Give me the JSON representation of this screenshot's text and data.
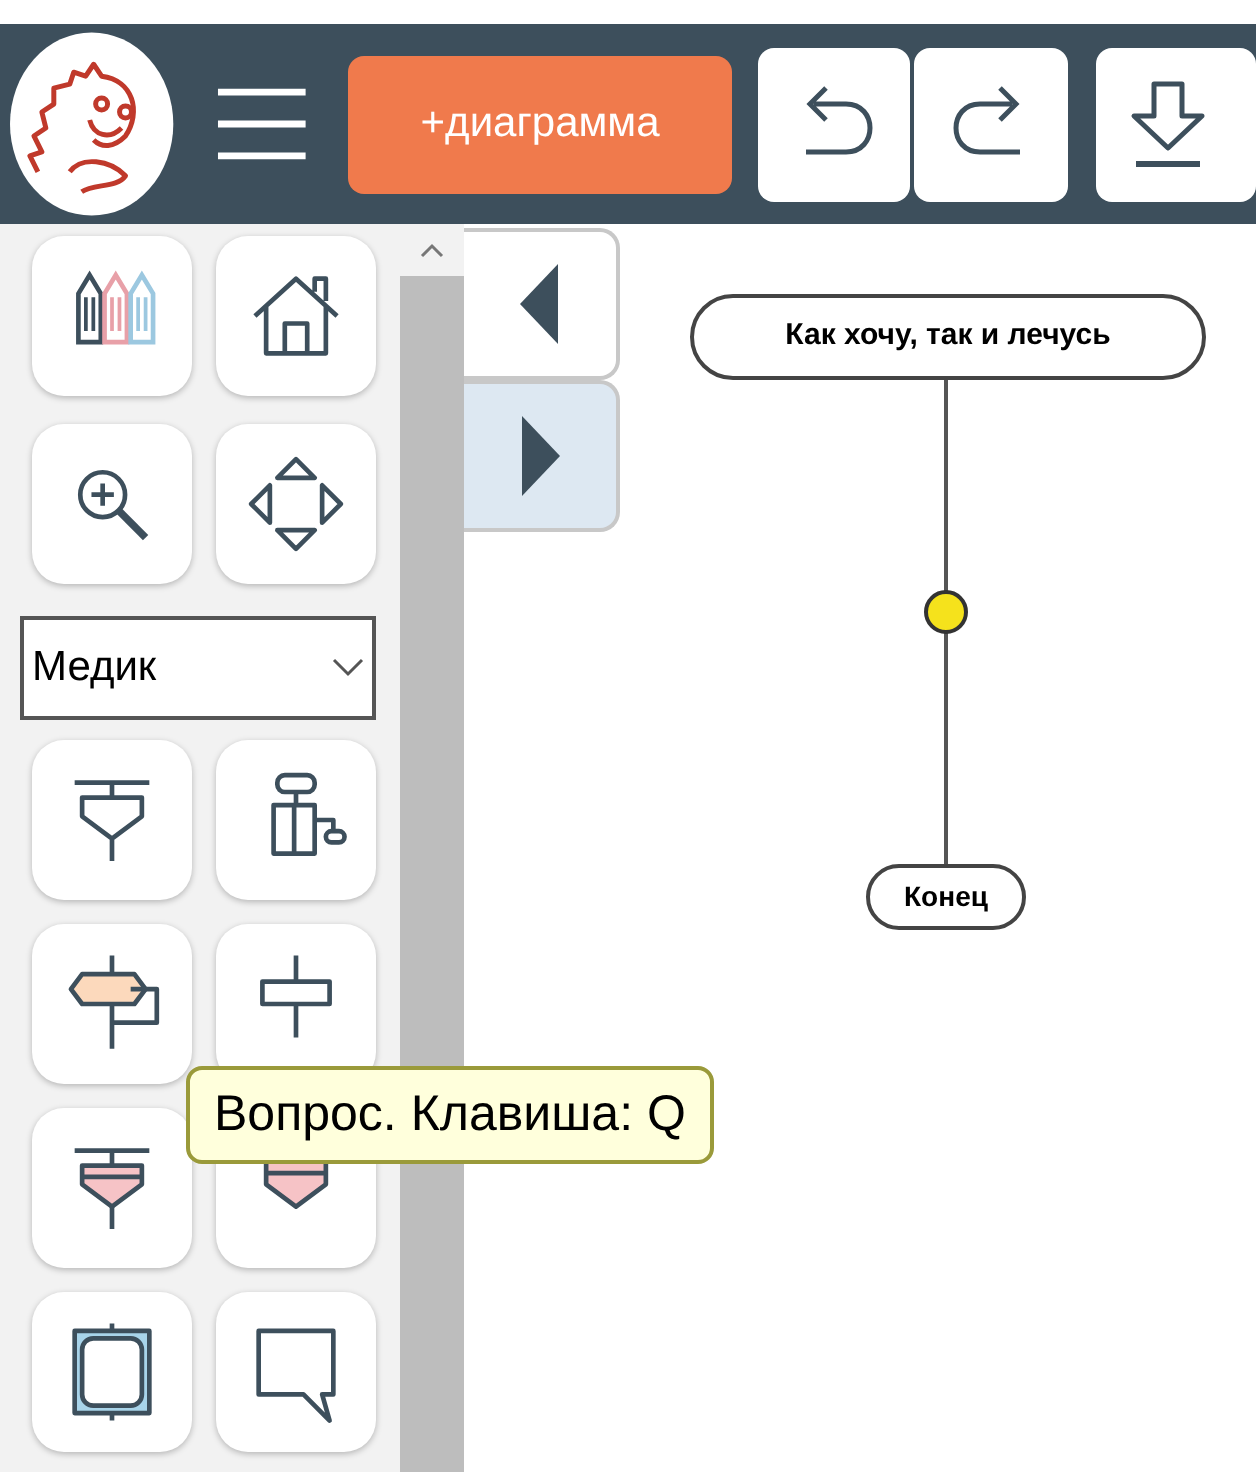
{
  "header": {
    "new_diagram_button": "+диаграмма"
  },
  "sidebar": {
    "tools_top": [
      {
        "kind": "pencils"
      },
      {
        "kind": "home"
      },
      {
        "kind": "zoom"
      },
      {
        "kind": "move"
      }
    ],
    "preset_select": {
      "value": "Медик"
    },
    "tools": [
      {
        "kind": "loop-start"
      },
      {
        "kind": "branch"
      },
      {
        "kind": "hex-loop"
      },
      {
        "kind": "action"
      },
      {
        "kind": "loop-start-pink"
      },
      {
        "kind": "loop-end-pink"
      },
      {
        "kind": "frame"
      },
      {
        "kind": "callout"
      }
    ]
  },
  "panel_tabs": [
    {
      "kind": "collapse",
      "selected": false
    },
    {
      "kind": "expand",
      "selected": true
    }
  ],
  "diagram": {
    "title_node": "Как хочу, так и лечусь",
    "end_node": "Конец"
  },
  "tooltip": "Вопрос. Клавиша: Q"
}
